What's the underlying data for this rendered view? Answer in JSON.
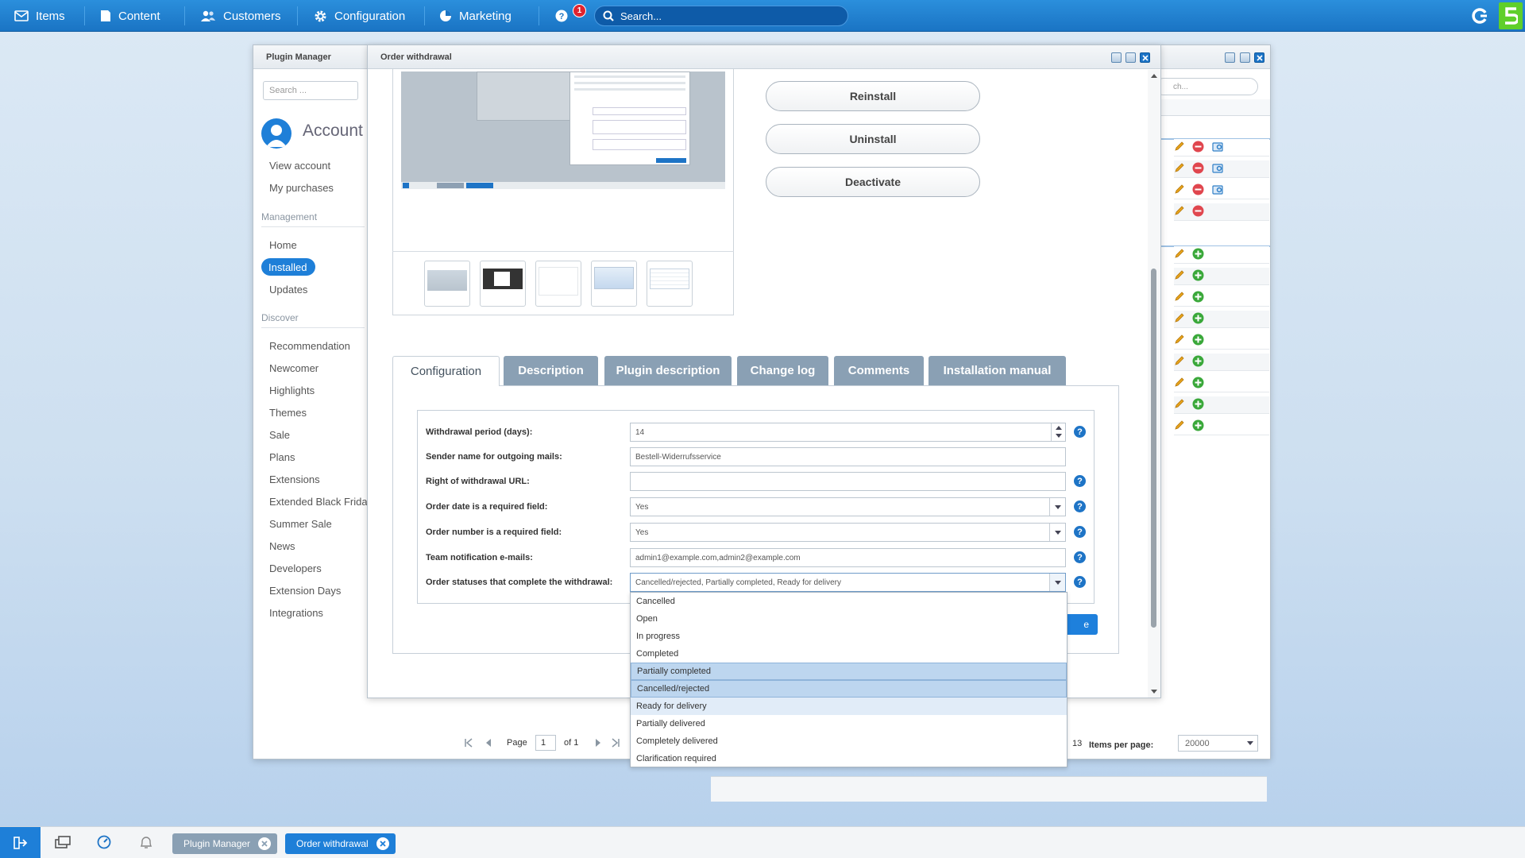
{
  "topbar": {
    "nav": [
      {
        "label": "Items",
        "icon": "mail-icon"
      },
      {
        "label": "Content",
        "icon": "document-icon"
      },
      {
        "label": "Customers",
        "icon": "users-icon"
      },
      {
        "label": "Configuration",
        "icon": "gear-icon"
      },
      {
        "label": "Marketing",
        "icon": "chart-pie-icon"
      }
    ],
    "notification_count": "1",
    "search_placeholder": "Search..."
  },
  "plugin_manager": {
    "title": "Plugin Manager",
    "search_placeholder": "Search ...",
    "account_heading": "Account",
    "account_links": [
      "View account",
      "My purchases"
    ],
    "management_heading": "Management",
    "management_links": [
      "Home",
      "Installed",
      "Updates"
    ],
    "discover_heading": "Discover",
    "discover_links": [
      "Recommendation",
      "Newcomer",
      "Highlights",
      "Themes",
      "Sale",
      "Plans",
      "Extensions",
      "Extended Black Friday",
      "Summer Sale",
      "News",
      "Developers",
      "Extension Days",
      "Integrations"
    ],
    "right_search_placeholder": "ch...",
    "pager": {
      "page_label": "Page",
      "page_value": "1",
      "of_label": "of 1",
      "total": "13",
      "items_per_page_label": "Items per page:",
      "items_per_page_value": "20000"
    }
  },
  "order_withdrawal": {
    "title": "Order withdrawal",
    "buttons": {
      "reinstall": "Reinstall",
      "uninstall": "Uninstall",
      "deactivate": "Deactivate"
    },
    "tabs": [
      "Configuration",
      "Description",
      "Plugin description",
      "Change log",
      "Comments",
      "Installation manual"
    ],
    "fields": [
      {
        "label": "Withdrawal period (days):",
        "value": "14",
        "type": "number",
        "help": true
      },
      {
        "label": "Sender name for outgoing mails:",
        "value": "Bestell-Widerrufsservice",
        "type": "text",
        "help": false
      },
      {
        "label": "Right of withdrawal URL:",
        "value": "",
        "type": "text",
        "help": true
      },
      {
        "label": "Order date is a required field:",
        "value": "Yes",
        "type": "select",
        "help": true
      },
      {
        "label": "Order number is a required field:",
        "value": "Yes",
        "type": "select",
        "help": true
      },
      {
        "label": "Team notification e-mails:",
        "value": "admin1@example.com,admin2@example.com",
        "type": "text",
        "help": true
      },
      {
        "label": "Order statuses that complete the withdrawal:",
        "value": "Cancelled/rejected, Partially completed, Ready for delivery",
        "type": "multiselect",
        "help": true
      }
    ],
    "dropdown_options": [
      "Cancelled",
      "Open",
      "In progress",
      "Completed",
      "Partially completed",
      "Cancelled/rejected",
      "Ready for delivery",
      "Partially delivered",
      "Completely delivered",
      "Clarification required"
    ],
    "save_label_fragment": "e"
  },
  "taskbar": {
    "items": [
      "Plugin Manager",
      "Order withdrawal"
    ]
  },
  "colors": {
    "topbar": "#1e7fd8",
    "accent": "#1e74c6",
    "tab_inactive": "#8aa0b4",
    "selected_option": "#bdd6ef"
  }
}
